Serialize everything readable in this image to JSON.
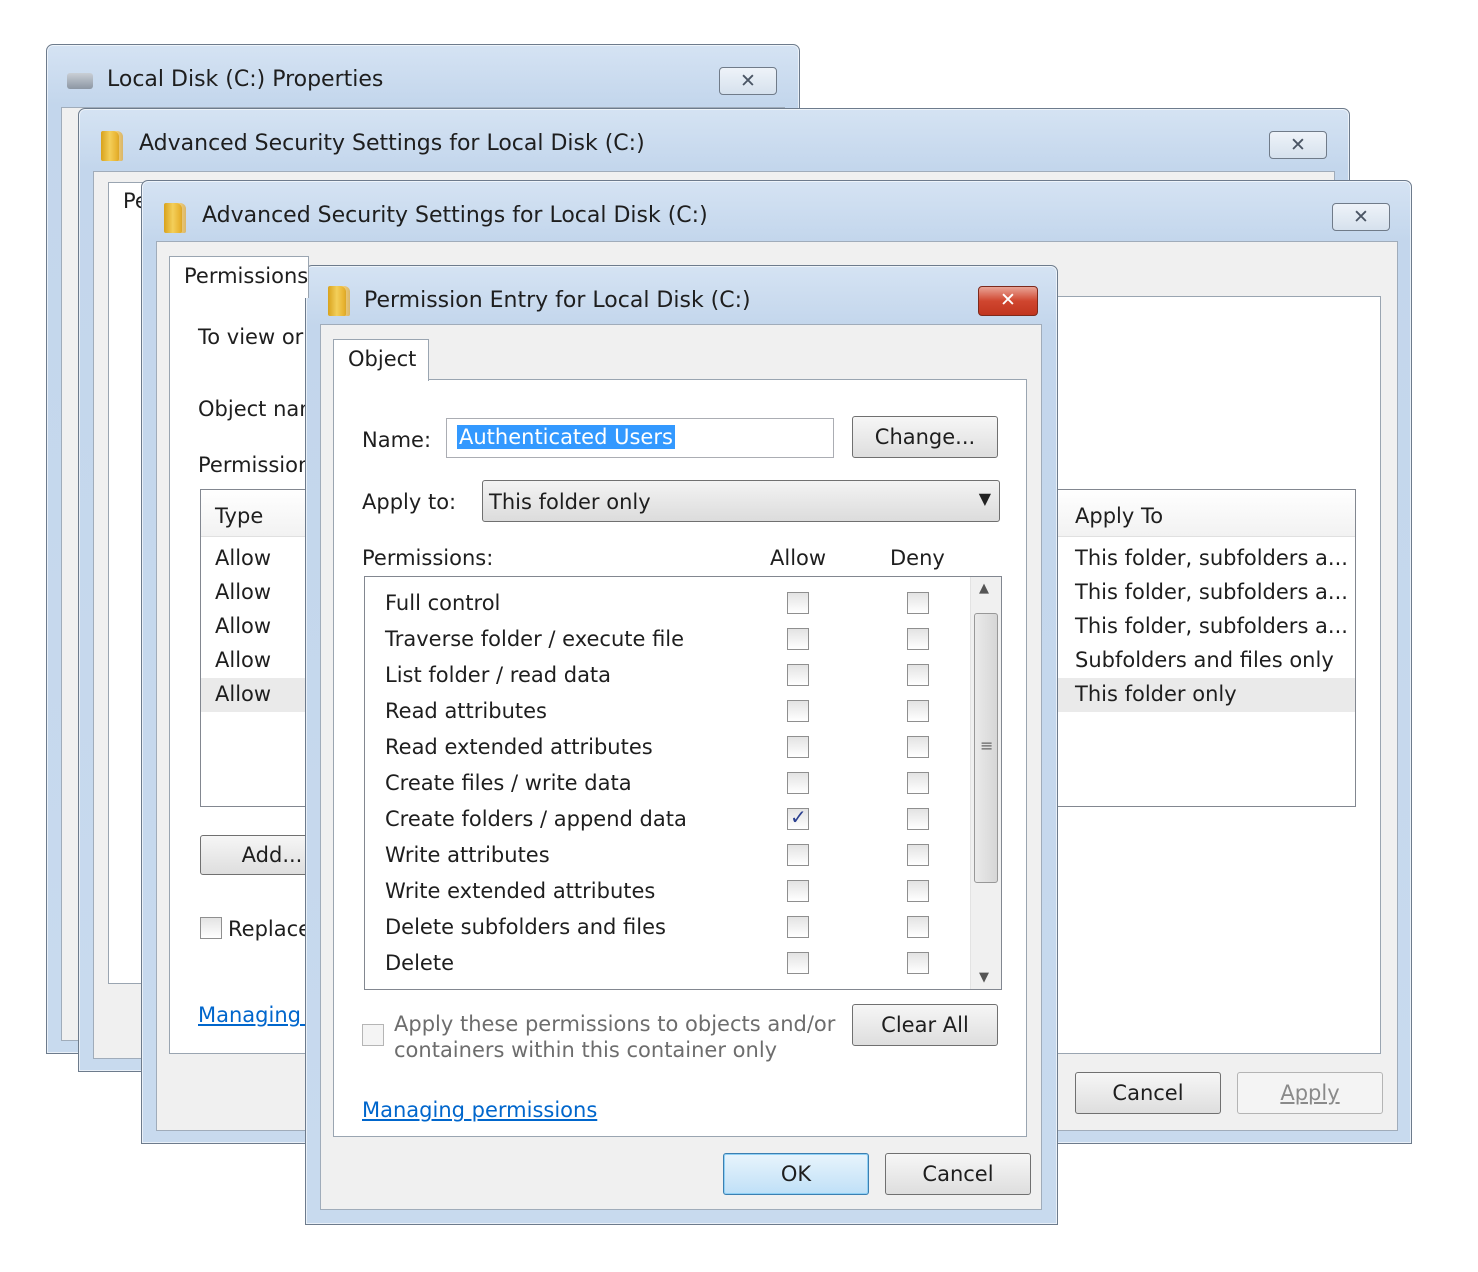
{
  "win_properties": {
    "title": "Local Disk (C:) Properties",
    "close": "✕"
  },
  "win_adv1": {
    "title": "Advanced Security Settings for Local Disk (C:)",
    "close": "✕",
    "fragment_pe": "Pe"
  },
  "win_adv2": {
    "title": "Advanced Security Settings for Local Disk (C:)",
    "close": "✕",
    "tab": "Permissions",
    "to_view": "To view or",
    "object_name": "Object nam",
    "permission_entries": "Permission",
    "columns": {
      "type": "Type",
      "apply_to": "Apply To"
    },
    "entries": [
      {
        "type": "Allow",
        "apply_to": "This folder, subfolders a..."
      },
      {
        "type": "Allow",
        "apply_to": "This folder, subfolders a..."
      },
      {
        "type": "Allow",
        "apply_to": "This folder, subfolders a..."
      },
      {
        "type": "Allow",
        "apply_to": "Subfolders and files only"
      },
      {
        "type": "Allow",
        "apply_to": "This folder only"
      }
    ],
    "add_button": "Add...",
    "replace_label": "Replace",
    "managing_link": "Managing p",
    "cancel_button": "Cancel",
    "apply_button": "Apply"
  },
  "dialog": {
    "title": "Permission Entry for Local Disk (C:)",
    "close": "✕",
    "tab": "Object",
    "name_label": "Name:",
    "name_value": "Authenticated Users",
    "change_button": "Change...",
    "apply_to_label": "Apply to:",
    "apply_to_value": "This folder only",
    "permissions_label": "Permissions:",
    "allow_header": "Allow",
    "deny_header": "Deny",
    "permissions": [
      {
        "name": "Full control",
        "allow": false,
        "deny": false
      },
      {
        "name": "Traverse folder / execute file",
        "allow": false,
        "deny": false
      },
      {
        "name": "List folder / read data",
        "allow": false,
        "deny": false
      },
      {
        "name": "Read attributes",
        "allow": false,
        "deny": false
      },
      {
        "name": "Read extended attributes",
        "allow": false,
        "deny": false
      },
      {
        "name": "Create files / write data",
        "allow": false,
        "deny": false
      },
      {
        "name": "Create folders / append data",
        "allow": true,
        "deny": false
      },
      {
        "name": "Write attributes",
        "allow": false,
        "deny": false
      },
      {
        "name": "Write extended attributes",
        "allow": false,
        "deny": false
      },
      {
        "name": "Delete subfolders and files",
        "allow": false,
        "deny": false
      },
      {
        "name": "Delete",
        "allow": false,
        "deny": false
      }
    ],
    "apply_container_line1": "Apply these permissions to objects and/or",
    "apply_container_line2": "containers within this container only",
    "clear_all_button": "Clear All",
    "managing_link": "Managing permissions",
    "ok_button": "OK",
    "cancel_button": "Cancel"
  }
}
